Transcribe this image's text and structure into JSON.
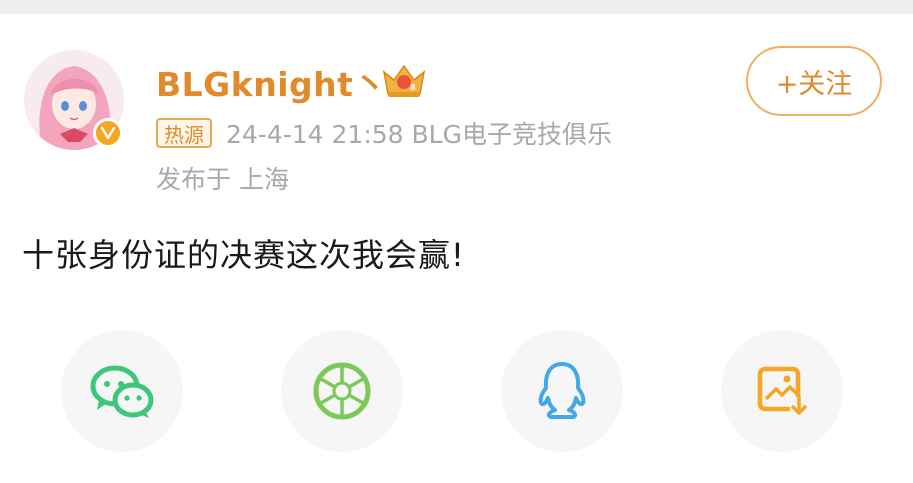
{
  "post": {
    "username": "BLGknight丶",
    "follow_label": "+关注",
    "hot_tag": "热源",
    "meta": "24-4-14 21:58  BLG电子竞技俱乐",
    "location": "发布于 上海",
    "text": "十张身份证的决赛这次我会赢!"
  },
  "colors": {
    "accent": "#e08a2c",
    "verified": "#f5a623",
    "wechat": "#3cc77a",
    "moments": "#7cc858",
    "qq": "#42a8e6",
    "save": "#f5a623"
  },
  "share": {
    "icons": [
      "wechat-icon",
      "moments-icon",
      "qq-icon",
      "save-image-icon"
    ]
  }
}
